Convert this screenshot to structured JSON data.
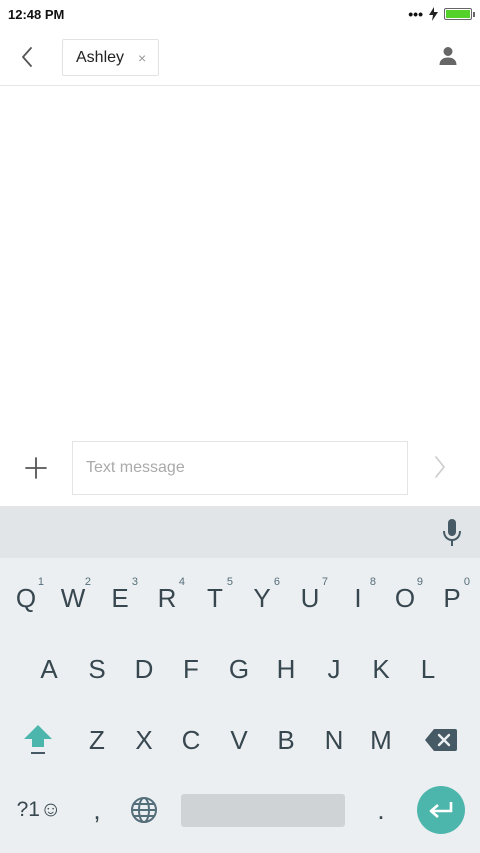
{
  "status_bar": {
    "time": "12:48 PM",
    "signal_dots": "•••",
    "battery_level": 1.0,
    "battery_color": "#55d22a"
  },
  "header": {
    "back_icon": "chevron-left-icon",
    "recipient_chip": {
      "label": "Ashley",
      "close_symbol": "×"
    },
    "contact_icon": "person-icon"
  },
  "compose": {
    "add_icon": "plus-icon",
    "text_placeholder": "Text message",
    "text_value": "",
    "send_icon": "chevron-right-icon"
  },
  "keyboard": {
    "mic_icon": "microphone-icon",
    "row1": [
      {
        "label": "Q",
        "hint": "1"
      },
      {
        "label": "W",
        "hint": "2"
      },
      {
        "label": "E",
        "hint": "3"
      },
      {
        "label": "R",
        "hint": "4"
      },
      {
        "label": "T",
        "hint": "5"
      },
      {
        "label": "Y",
        "hint": "6"
      },
      {
        "label": "U",
        "hint": "7"
      },
      {
        "label": "I",
        "hint": "8"
      },
      {
        "label": "O",
        "hint": "9"
      },
      {
        "label": "P",
        "hint": "0"
      }
    ],
    "row2": [
      "A",
      "S",
      "D",
      "F",
      "G",
      "H",
      "J",
      "K",
      "L"
    ],
    "row3": [
      "Z",
      "X",
      "C",
      "V",
      "B",
      "N",
      "M"
    ],
    "symbols_label": "?1☺",
    "comma_label": ",",
    "period_label": ".",
    "accent_color": "#4db6ac"
  }
}
